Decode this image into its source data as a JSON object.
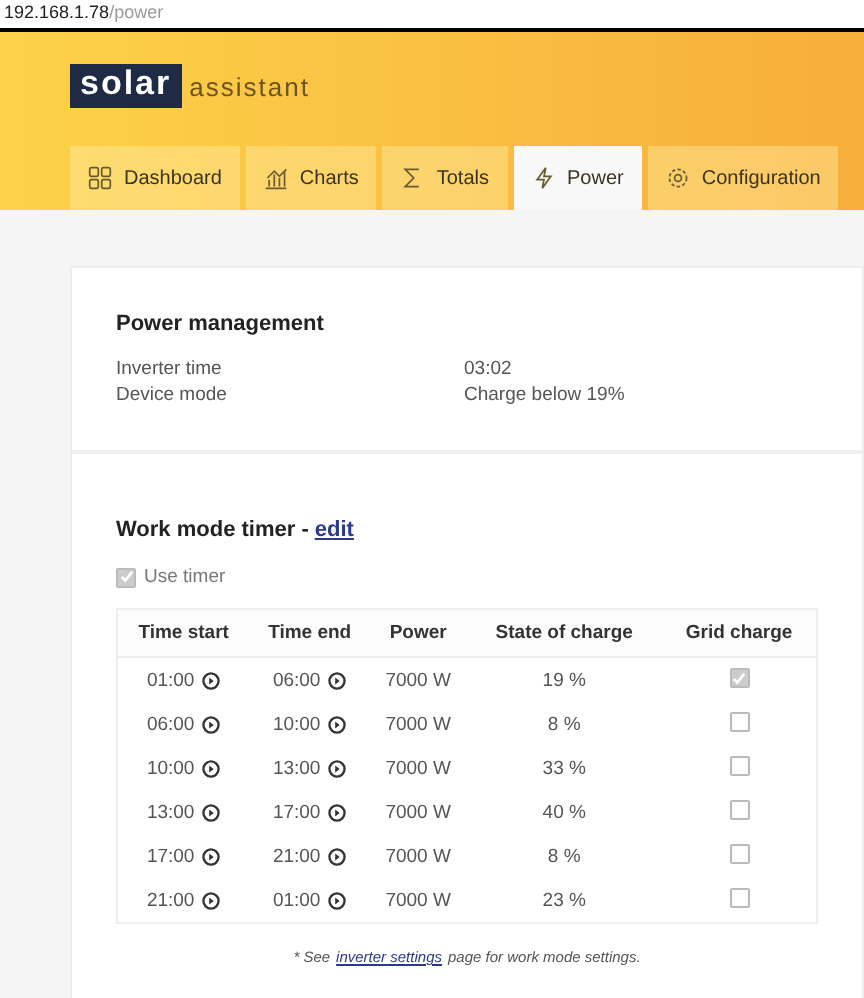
{
  "address_bar": {
    "host": "192.168.1.78",
    "path": "/power"
  },
  "logo": {
    "mark": "solar",
    "text": "assistant"
  },
  "tabs": [
    {
      "label": "Dashboard",
      "kind": "grid",
      "selected": false
    },
    {
      "label": "Charts",
      "kind": "chart",
      "selected": false
    },
    {
      "label": "Totals",
      "kind": "sigma",
      "selected": false
    },
    {
      "label": "Power",
      "kind": "bolt",
      "selected": true
    },
    {
      "label": "Configuration",
      "kind": "gear",
      "selected": false
    }
  ],
  "power_management": {
    "title": "Power management",
    "fields": [
      {
        "label": "Inverter time",
        "value": "03:02"
      },
      {
        "label": "Device mode",
        "value": "Charge below 19%"
      }
    ]
  },
  "work_mode_timer": {
    "title": "Work mode timer -",
    "edit_link": "edit",
    "use_timer": {
      "label": "Use timer",
      "checked": true
    },
    "table": {
      "columns": [
        "Time start",
        "Time end",
        "Power",
        "State of charge",
        "Grid charge"
      ],
      "rows": [
        {
          "time_start": "01:00",
          "time_end": "06:00",
          "power": "7000 W",
          "state_of_charge": "19 %",
          "grid_charge": true
        },
        {
          "time_start": "06:00",
          "time_end": "10:00",
          "power": "7000 W",
          "state_of_charge": "8 %",
          "grid_charge": false
        },
        {
          "time_start": "10:00",
          "time_end": "13:00",
          "power": "7000 W",
          "state_of_charge": "33 %",
          "grid_charge": false
        },
        {
          "time_start": "13:00",
          "time_end": "17:00",
          "power": "7000 W",
          "state_of_charge": "40 %",
          "grid_charge": false
        },
        {
          "time_start": "17:00",
          "time_end": "21:00",
          "power": "7000 W",
          "state_of_charge": "8 %",
          "grid_charge": false
        },
        {
          "time_start": "21:00",
          "time_end": "01:00",
          "power": "7000 W",
          "state_of_charge": "23 %",
          "grid_charge": false
        }
      ]
    },
    "footnote": {
      "before": "* See",
      "link": "inverter settings",
      "after": "page for work mode settings."
    }
  }
}
